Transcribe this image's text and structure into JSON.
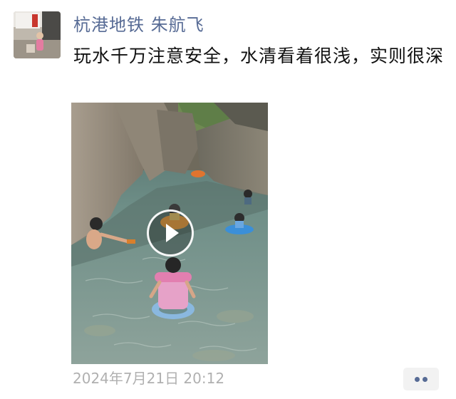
{
  "post": {
    "author": "杭港地铁 朱航飞",
    "text": "玩水千万注意安全，水清看着很浅，实则很深",
    "timestamp": "2024年7月21日 20:12"
  },
  "media": {
    "type": "video",
    "icon": "play-icon"
  },
  "actions": {
    "more_icon": "more-dots-icon"
  },
  "colors": {
    "author_name": "#576b95",
    "body_text": "#111111",
    "timestamp": "#b0b0b0",
    "more_button_bg": "#f2f2f2"
  }
}
